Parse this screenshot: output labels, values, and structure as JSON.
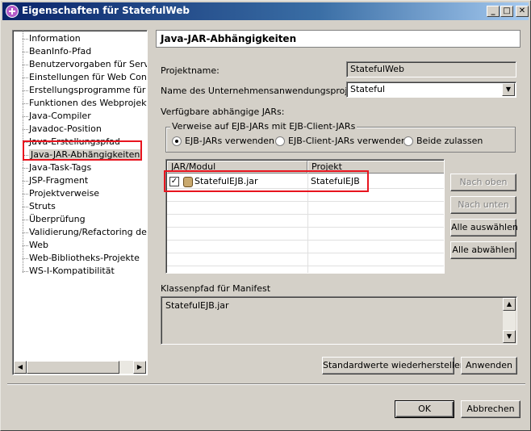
{
  "window": {
    "title": "Eigenschaften für StatefulWeb",
    "controls": {
      "minimize": "_",
      "maximize": "□",
      "close": "✕"
    }
  },
  "tree": {
    "items": [
      "Information",
      "BeanInfo-Pfad",
      "Benutzervorgaben für Server",
      "Einstellungen für Web Content",
      "Erstellungsprogramme für exte",
      "Funktionen des Webprojekts",
      "Java-Compiler",
      "Javadoc-Position",
      "Java-Erstellungspfad",
      "Java-JAR-Abhängigkeiten",
      "Java-Task-Tags",
      "JSP-Fragment",
      "Projektverweise",
      "Struts",
      "Überprüfung",
      "Validierung/Refactoring der Lir",
      "Web",
      "Web-Bibliotheks-Projekte",
      "WS-I-Kompatibilität"
    ],
    "selected": "Java-JAR-Abhängigkeiten"
  },
  "page": {
    "header": "Java-JAR-Abhängigkeiten",
    "project_name_label": "Projektname:",
    "project_name_value": "StatefulWeb",
    "ear_project_label": "Name des Unternehmensanwendungsprojekts:",
    "ear_project_value": "Stateful",
    "available_jars_label": "Verfügbare abhängige JARs:",
    "group_title": "Verweise auf EJB-JARs mit EJB-Client-JARs",
    "radios": [
      {
        "label": "EJB-JARs verwenden",
        "checked": true
      },
      {
        "label": "EJB-Client-JARs verwenden",
        "checked": false
      },
      {
        "label": "Beide zulassen",
        "checked": false
      }
    ],
    "table": {
      "columns": [
        "JAR/Modul",
        "Projekt"
      ],
      "rows": [
        {
          "jar": "StatefulEJB.jar",
          "project": "StatefulEJB",
          "checked": true
        }
      ]
    },
    "side_buttons": {
      "up": "Nach oben",
      "down": "Nach unten",
      "select_all": "Alle auswählen",
      "deselect_all": "Alle abwählen"
    },
    "manifest_label": "Klassenpfad für Manifest",
    "manifest_value": "StatefulEJB.jar",
    "restore_defaults": "Standardwerte wiederherstellen",
    "apply": "Anwenden"
  },
  "dialog_buttons": {
    "ok": "OK",
    "cancel": "Abbrechen"
  },
  "annotation_color": "#e8141e"
}
